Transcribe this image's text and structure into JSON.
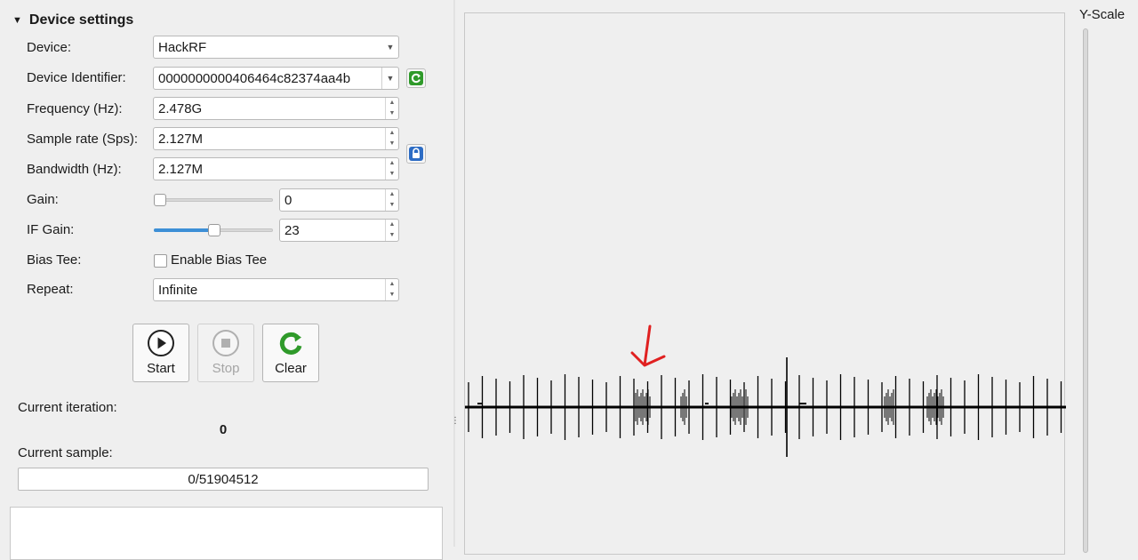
{
  "section": {
    "title": "Device settings"
  },
  "fields": {
    "device": {
      "label": "Device:",
      "value": "HackRF"
    },
    "identifier": {
      "label": "Device Identifier:",
      "value": "0000000000406464c82374aa4b"
    },
    "frequency": {
      "label": "Frequency (Hz):",
      "value": "2.478G"
    },
    "sample_rate": {
      "label": "Sample rate (Sps):",
      "value": "2.127M"
    },
    "bandwidth": {
      "label": "Bandwidth (Hz):",
      "value": "2.127M"
    },
    "gain": {
      "label": "Gain:",
      "value": "0",
      "slider_fraction": 0.0
    },
    "if_gain": {
      "label": "IF Gain:",
      "value": "23",
      "slider_fraction": 0.5
    },
    "bias_tee": {
      "label": "Bias Tee:",
      "checkbox_label": "Enable Bias Tee",
      "checked": false
    },
    "repeat": {
      "label": "Repeat:",
      "value": "Infinite"
    }
  },
  "buttons": {
    "start": "Start",
    "stop": "Stop",
    "clear": "Clear"
  },
  "status": {
    "iteration_label": "Current iteration:",
    "iteration_value": "0",
    "sample_label": "Current sample:",
    "sample_value": "0/51904512"
  },
  "plot": {
    "yscale_label": "Y-Scale"
  },
  "colors": {
    "accent": "#3d8fd6",
    "refresh_green": "#2f9a2a",
    "lock_blue": "#2d6cc4",
    "annotation_red": "#e02020"
  }
}
